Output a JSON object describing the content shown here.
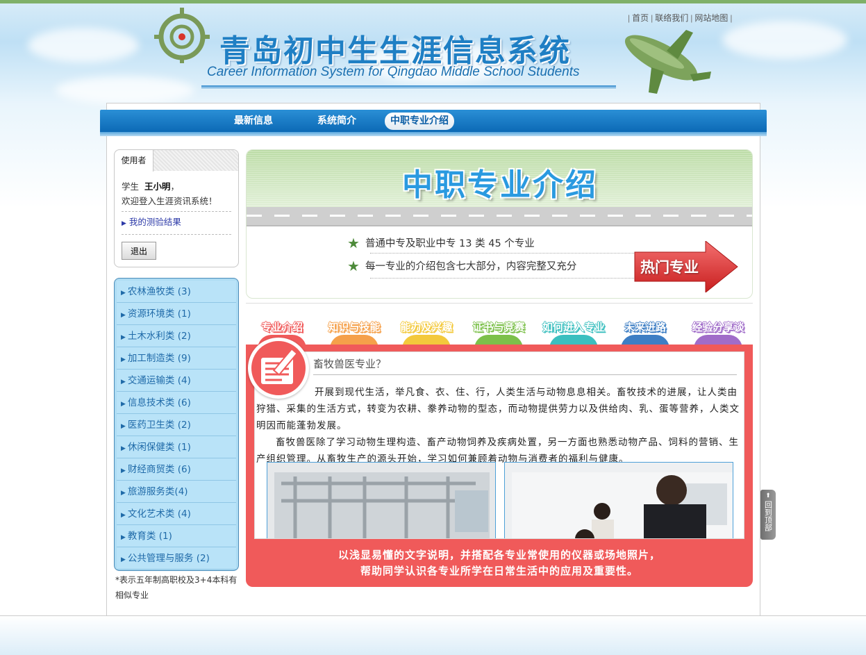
{
  "header": {
    "title_cn": "青岛初中生生涯信息系统",
    "title_en": "Career Information System for Qingdao Middle School Students",
    "toplinks": [
      "首页",
      "联络我们",
      "网站地图"
    ]
  },
  "nav": {
    "items": [
      "最新信息",
      "系统简介",
      "中职专业介绍"
    ],
    "active_index": 2
  },
  "user": {
    "tab_label": "使用者",
    "role": "学生",
    "name": "王小明",
    "welcome": "欢迎登入生涯资讯系统！",
    "result_link": "我的测验结果",
    "logout_label": "退出"
  },
  "categories": [
    "农林渔牧类 (3)",
    "资源环境类 (1)",
    "土木水利类 (2)",
    "加工制造类 (9)",
    "交通运输类 (4)",
    "信息技术类 (6)",
    "医药卫生类 (2)",
    "休闲保健类 (1)",
    "财经商贸类 (6)",
    "旅游服务类(4)",
    "文化艺术类 (4)",
    "教育类 (1)",
    "公共管理与服务 (2)"
  ],
  "note": "*表示五年制高职校及3+4本科有相似专业",
  "banner": {
    "title": "中职专业介绍",
    "bullets": [
      "普通中专及职业中专 13 类 45 个专业",
      "每一专业的介绍包含七大部分，内容完整又充分"
    ],
    "hot_label": "热门专业"
  },
  "tabs": [
    {
      "label": "专业介绍",
      "color": "#f05a5a"
    },
    {
      "label": "知识与技能",
      "color": "#f5a04a"
    },
    {
      "label": "能力及兴趣",
      "color": "#f3c93c"
    },
    {
      "label": "证书与竞赛",
      "color": "#7cc04a"
    },
    {
      "label": "如何进入专业",
      "color": "#3bbfbf"
    },
    {
      "label": "未来进路",
      "color": "#3d7ec4"
    },
    {
      "label": "经验分享谈",
      "color": "#a06cc9"
    }
  ],
  "panel": {
    "question": "畜牧兽医专业？",
    "para1": "开展到现代生活，举凡食、衣、住、行，人类生活与动物息息相关。畜牧技术的进展，让人类由狩猎、采集的生活方式，转变为农耕、豢养动物的型态，而动物提供劳力以及供给肉、乳、蛋等营养，人类文明因而能蓬勃发展。",
    "para2": "畜牧兽医除了学习动物生理构造、畜产动物饲养及疾病处置，另一方面也熟悉动物产品、饲料的营销、生产组织管理。从畜牧生产的源头开始，学习如何兼顾着动物与消费者的福利与健康。",
    "caption1": "以浅显易懂的文字说明，并搭配各专业常使用的仪器或场地照片，",
    "caption2": "帮助同学认识各专业所学在日常生活中的应用及重要性。"
  },
  "backtop": "回到顶部",
  "colors": {
    "nav_blue": "#0a67b4",
    "panel_red": "#f05a5a",
    "category_bg": "#b9e3f8",
    "link_blue": "#2d3aa8"
  }
}
